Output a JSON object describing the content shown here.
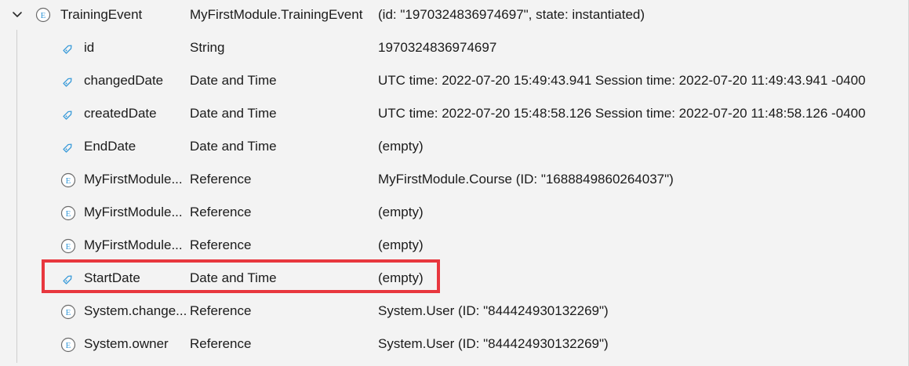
{
  "colors": {
    "background": "#f3f3f3",
    "text": "#1b1b1b",
    "icon_blue": "#3a9bd9",
    "icon_grey": "#6b6b6b",
    "highlight": "#e8373e"
  },
  "root": {
    "name": "TrainingEvent",
    "type": "MyFirstModule.TrainingEvent",
    "value": "(id: \"1970324836974697\", state: instantiated)",
    "icon": "entity-icon",
    "expanded": true
  },
  "rows": [
    {
      "name": "id",
      "type": "String",
      "value": "1970324836974697",
      "icon": "attribute-icon"
    },
    {
      "name": "changedDate",
      "type": "Date and Time",
      "value": "UTC time: 2022-07-20 15:49:43.941 Session time: 2022-07-20 11:49:43.941 -0400",
      "icon": "attribute-icon"
    },
    {
      "name": "createdDate",
      "type": "Date and Time",
      "value": "UTC time: 2022-07-20 15:48:58.126 Session time: 2022-07-20 11:48:58.126 -0400",
      "icon": "attribute-icon"
    },
    {
      "name": "EndDate",
      "type": "Date and Time",
      "value": "(empty)",
      "icon": "attribute-icon"
    },
    {
      "name": "MyFirstModule...",
      "type": "Reference",
      "value": "MyFirstModule.Course (ID: \"1688849860264037\")",
      "icon": "entity-icon"
    },
    {
      "name": "MyFirstModule...",
      "type": "Reference",
      "value": "(empty)",
      "icon": "entity-icon"
    },
    {
      "name": "MyFirstModule...",
      "type": "Reference",
      "value": "(empty)",
      "icon": "entity-icon"
    },
    {
      "name": "StartDate",
      "type": "Date and Time",
      "value": "(empty)",
      "icon": "attribute-icon",
      "highlighted": true
    },
    {
      "name": "System.change...",
      "type": "Reference",
      "value": "System.User (ID: \"844424930132269\")",
      "icon": "entity-icon"
    },
    {
      "name": "System.owner",
      "type": "Reference",
      "value": "System.User (ID: \"844424930132269\")",
      "icon": "entity-icon"
    }
  ]
}
